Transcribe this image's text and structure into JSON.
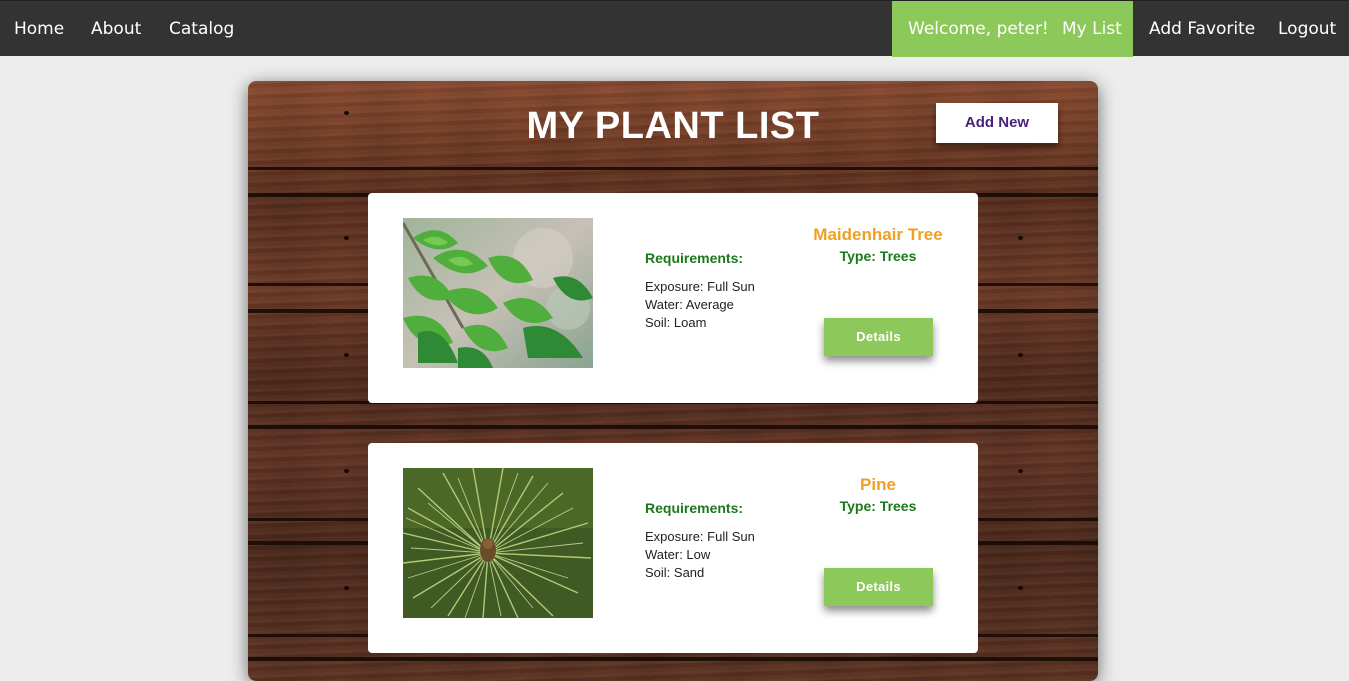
{
  "nav": {
    "home": "Home",
    "about": "About",
    "catalog": "Catalog",
    "welcome": "Welcome, peter!",
    "my_list": "My List",
    "add_favorite": "Add Favorite",
    "logout": "Logout"
  },
  "colors": {
    "navbar_bg": "#333333",
    "accent_green": "#8cc85a",
    "plant_name_orange": "#f0a020",
    "label_green": "#1a7a1a",
    "add_new_text": "#4a1f7a"
  },
  "page": {
    "title": "MY PLANT LIST",
    "add_new_label": "Add New"
  },
  "plants": [
    {
      "name": "Maidenhair Tree",
      "type": "Type: Trees",
      "requirements_label": "Requirements:",
      "exposure": "Exposure: Full Sun",
      "water": "Water: Average",
      "soil": "Soil: Loam",
      "details_label": "Details",
      "photo": "ginkgo-leaves-photo"
    },
    {
      "name": "Pine",
      "type": "Type: Trees",
      "requirements_label": "Requirements:",
      "exposure": "Exposure: Full Sun",
      "water": "Water: Low",
      "soil": "Soil: Sand",
      "details_label": "Details",
      "photo": "pine-needles-photo"
    }
  ]
}
